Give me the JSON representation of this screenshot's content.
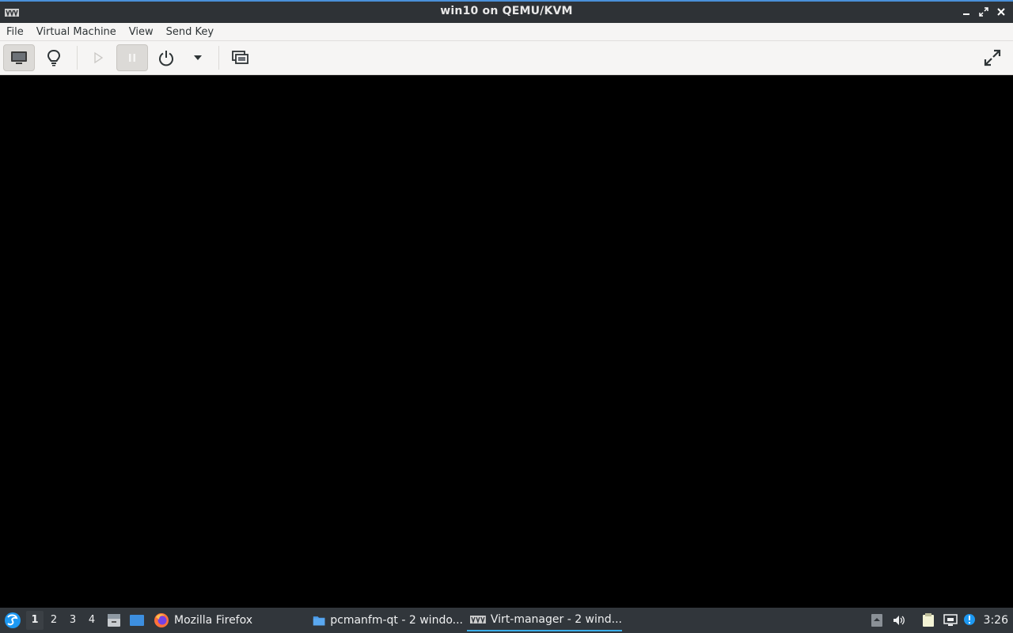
{
  "window": {
    "title": "win10 on QEMU/KVM",
    "minimize_glyph": "▁",
    "maximize_glyph": "⤢",
    "close_glyph": "✕"
  },
  "menubar": {
    "items": [
      {
        "label": "File"
      },
      {
        "label": "Virtual Machine"
      },
      {
        "label": "View"
      },
      {
        "label": "Send Key"
      }
    ]
  },
  "toolbar": {
    "buttons": [
      {
        "name": "console-button",
        "icon": "monitor-icon",
        "active": true
      },
      {
        "name": "details-button",
        "icon": "lightbulb-icon",
        "active": false
      },
      {
        "name": "run-button",
        "icon": "play-icon",
        "disabled": true
      },
      {
        "name": "pause-button",
        "icon": "pause-icon",
        "active": true
      },
      {
        "name": "shutdown-button",
        "icon": "power-icon"
      },
      {
        "name": "shutdown-menu-button",
        "icon": "caret-down-icon"
      },
      {
        "name": "snapshots-button",
        "icon": "snapshot-icon"
      },
      {
        "name": "fullscreen-button",
        "icon": "fullscreen-icon"
      }
    ]
  },
  "taskbar": {
    "desktops": [
      "1",
      "2",
      "3",
      "4"
    ],
    "current_desktop": "1",
    "tasks": [
      {
        "label": "Mozilla Firefox",
        "icon": "firefox-icon"
      },
      {
        "label": "pcmanfm-qt - 2 windo...",
        "icon": "folder-icon"
      },
      {
        "label": "Virt-manager - 2 wind...",
        "icon": "virt-manager-icon",
        "active": true
      }
    ],
    "clock": "3:26"
  },
  "colors": {
    "titlebar": "#2e3236",
    "accent": "#4a90d9",
    "taskbar": "#31363b",
    "task_active_underline": "#3daee9",
    "toolbar_bg": "#f6f5f4"
  }
}
